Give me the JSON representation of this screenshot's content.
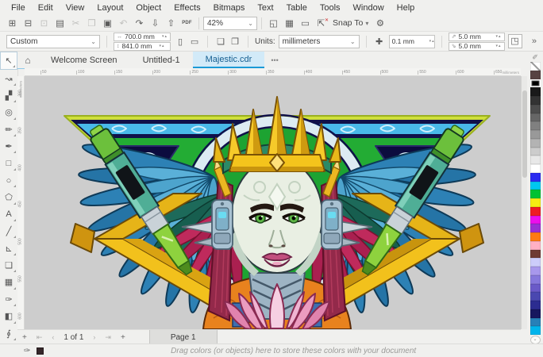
{
  "menu": {
    "items": [
      "File",
      "Edit",
      "View",
      "Layout",
      "Object",
      "Effects",
      "Bitmaps",
      "Text",
      "Table",
      "Tools",
      "Window",
      "Help"
    ]
  },
  "toolbar": {
    "icons_main": [
      {
        "name": "new-document-icon",
        "glyph": "⊞"
      },
      {
        "name": "open-icon",
        "glyph": "⊟"
      },
      {
        "name": "save-icon",
        "glyph": "⊡",
        "disabled": true
      },
      {
        "name": "print-icon",
        "glyph": "▤"
      },
      {
        "name": "cut-icon",
        "glyph": "✂",
        "disabled": true
      },
      {
        "name": "copy-icon",
        "glyph": "❐",
        "disabled": true
      },
      {
        "name": "paste-icon",
        "glyph": "▣"
      },
      {
        "name": "undo-icon",
        "glyph": "↶",
        "disabled": true
      },
      {
        "name": "redo-icon",
        "glyph": "↷"
      },
      {
        "name": "import-icon",
        "glyph": "⇩"
      },
      {
        "name": "export-icon",
        "glyph": "⇧"
      }
    ],
    "pdf_label": "PDF",
    "zoom_value": "42%",
    "zoom_caret": "⌄",
    "icons_view": [
      {
        "name": "fullscreen-preview-icon",
        "glyph": "◱"
      },
      {
        "name": "view-grid-icon",
        "glyph": "▦"
      },
      {
        "name": "page-border-icon",
        "glyph": "▭"
      }
    ],
    "snap_off_glyph": "⇱",
    "snap_off_overlay": "✕",
    "snap_label": "Snap To",
    "snap_caret": "▾",
    "gear_glyph": "⚙"
  },
  "propbar": {
    "preset_value": "Custom",
    "preset_caret": "⌄",
    "page_width_prefix": "↔",
    "page_width": "700.0 mm",
    "page_height_prefix": "↕",
    "page_height": "841.0 mm",
    "spin_glyphs": "▾▴",
    "orientation_icons": [
      {
        "name": "portrait-icon",
        "glyph": "▯",
        "active": true
      },
      {
        "name": "landscape-icon",
        "glyph": "▭"
      }
    ],
    "page_scope_icons": [
      {
        "name": "all-pages-icon",
        "glyph": "❏"
      },
      {
        "name": "current-page-icon",
        "glyph": "❐"
      }
    ],
    "units_label": "Units:",
    "units_value": "millimeters",
    "units_caret": "⌄",
    "nudge_glyph": "✚",
    "nudge_value": "0.1 mm",
    "duplicate_fields": [
      {
        "name": "duplicate-distance-x",
        "glyph": "⇗",
        "value": "5.0 mm"
      },
      {
        "name": "duplicate-distance-y",
        "glyph": "⇘",
        "value": "5.0 mm"
      }
    ],
    "treat_as_filled_glyph": "◳",
    "overflow_glyph": "»"
  },
  "tabs": {
    "home_glyph": "⌂",
    "items": [
      {
        "name": "tab-welcome-screen",
        "label": "Welcome Screen"
      },
      {
        "name": "tab-untitled-1",
        "label": "Untitled-1"
      },
      {
        "name": "tab-majestic",
        "label": "Majestic.cdr",
        "active": true
      }
    ],
    "more_glyph": "•••"
  },
  "toolbox": [
    {
      "name": "pick-tool",
      "glyph": "↖",
      "selected": true
    },
    {
      "name": "shape-tool",
      "glyph": "↝"
    },
    {
      "name": "crop-tool",
      "glyph": "▞"
    },
    {
      "name": "zoom-tool",
      "glyph": "◎"
    },
    {
      "name": "freehand-tool",
      "glyph": "✏"
    },
    {
      "name": "artistic-media-tool",
      "glyph": "✒"
    },
    {
      "name": "rectangle-tool",
      "glyph": "□"
    },
    {
      "name": "ellipse-tool",
      "glyph": "○"
    },
    {
      "name": "polygon-tool",
      "glyph": "⬠"
    },
    {
      "name": "text-tool",
      "glyph": "A"
    },
    {
      "name": "line-tool",
      "glyph": "╱"
    },
    {
      "name": "connector-tool",
      "glyph": "⊾"
    },
    {
      "name": "shadow-tool",
      "glyph": "❏"
    },
    {
      "name": "transparency-tool",
      "glyph": "▦"
    },
    {
      "name": "eyedropper-tool",
      "glyph": "✑"
    },
    {
      "name": "fill-tool",
      "glyph": "◧"
    },
    {
      "name": "interactive-fill-tool",
      "glyph": "∮"
    }
  ],
  "ruler": {
    "h_ticks": [
      "50",
      "100",
      "150",
      "200",
      "250",
      "300",
      "350",
      "400",
      "450",
      "500",
      "550",
      "600",
      "650"
    ],
    "v_ticks": [
      "300",
      "350",
      "400",
      "450",
      "500",
      "550",
      "600"
    ],
    "unit_label": "millimeters"
  },
  "palette": {
    "options_glyph": "✐",
    "scroll_glyph": "⌄",
    "swatches": [
      {
        "name": "no-color-swatch",
        "none": true
      },
      {
        "name": "color-swatch",
        "color": "#574242"
      },
      {
        "name": "color-swatch",
        "color": "#000000",
        "selected": true
      },
      {
        "name": "color-swatch",
        "color": "#1a1a1a"
      },
      {
        "name": "color-swatch",
        "color": "#333333"
      },
      {
        "name": "color-swatch",
        "color": "#4d4d4d"
      },
      {
        "name": "color-swatch",
        "color": "#666666"
      },
      {
        "name": "color-swatch",
        "color": "#808080"
      },
      {
        "name": "color-swatch",
        "color": "#999999"
      },
      {
        "name": "color-swatch",
        "color": "#b3b3b3"
      },
      {
        "name": "color-swatch",
        "color": "#cccccc"
      },
      {
        "name": "color-swatch",
        "color": "#e8e8e8"
      },
      {
        "name": "color-swatch",
        "color": "#ffffff"
      },
      {
        "name": "color-swatch",
        "color": "#2b2bf0"
      },
      {
        "name": "color-swatch",
        "color": "#00c8f0"
      },
      {
        "name": "color-swatch",
        "color": "#00c232"
      },
      {
        "name": "color-swatch",
        "color": "#f5ee12"
      },
      {
        "name": "color-swatch",
        "color": "#ee1c24"
      },
      {
        "name": "color-swatch",
        "color": "#ec0fec"
      },
      {
        "name": "color-swatch",
        "color": "#9a2fd4"
      },
      {
        "name": "color-swatch",
        "color": "#ff7a12"
      },
      {
        "name": "color-swatch",
        "color": "#ffb0c4"
      },
      {
        "name": "color-swatch",
        "color": "#6e3a34"
      },
      {
        "name": "color-swatch",
        "color": "#ccccfa"
      },
      {
        "name": "color-swatch",
        "color": "#a898ec"
      },
      {
        "name": "color-swatch",
        "color": "#8678dc"
      },
      {
        "name": "color-swatch",
        "color": "#6a5ac8"
      },
      {
        "name": "color-swatch",
        "color": "#4a48b0"
      },
      {
        "name": "color-swatch",
        "color": "#2c2c90"
      },
      {
        "name": "color-swatch",
        "color": "#17175e"
      },
      {
        "name": "color-swatch",
        "color": "#2780b8"
      },
      {
        "name": "color-swatch",
        "color": "#00b4ec"
      }
    ]
  },
  "pagebar": {
    "add_page_left": "+",
    "first_page": "⇤",
    "prev_page": "‹",
    "page_indicator": "1 of 1",
    "next_page": "›",
    "last_page": "⇥",
    "add_page_right": "+",
    "page_tab": "Page 1"
  },
  "statusbar": {
    "outline_glyph": "✑",
    "fill_color": "#35272a",
    "hint": "Drag colors (or objects) here to store these colors with your document"
  }
}
